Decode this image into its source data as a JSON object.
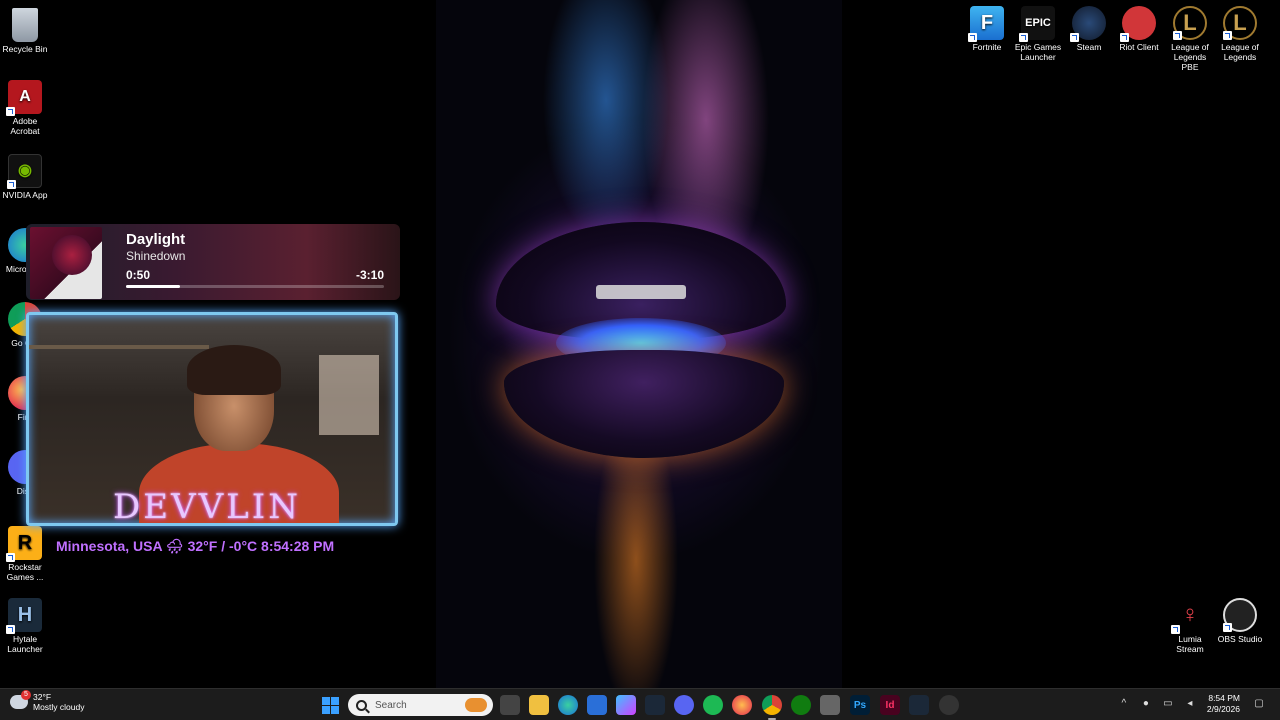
{
  "desktop_icons_left": [
    {
      "label": "Recycle Bin",
      "icon": "recycle-bin-icon"
    },
    {
      "label": "Adobe Acrobat",
      "icon": "adobe-acrobat-icon"
    },
    {
      "label": "NVIDIA App",
      "icon": "nvidia-icon"
    },
    {
      "label": "Micro Edg",
      "icon": "edge-icon"
    },
    {
      "label": "Go Chr",
      "icon": "chrome-icon"
    },
    {
      "label": "Fire",
      "icon": "firefox-icon"
    },
    {
      "label": "Disc",
      "icon": "discord-icon"
    },
    {
      "label": "Rockstar Games ...",
      "icon": "rockstar-icon"
    },
    {
      "label": "Hytale Launcher",
      "icon": "hytale-icon"
    }
  ],
  "desktop_icons_top_right": [
    {
      "label": "Fortnite",
      "icon": "fortnite-icon"
    },
    {
      "label": "Epic Games Launcher",
      "icon": "epic-games-icon",
      "glyph": "EPIC"
    },
    {
      "label": "Steam",
      "icon": "steam-icon"
    },
    {
      "label": "Riot Client",
      "icon": "riot-icon"
    },
    {
      "label": "League of Legends PBE",
      "icon": "league-pbe-icon"
    },
    {
      "label": "League of Legends",
      "icon": "league-icon"
    }
  ],
  "desktop_icons_bottom_right": [
    {
      "label": "Lumia Stream",
      "icon": "lumia-stream-icon"
    },
    {
      "label": "OBS Studio",
      "icon": "obs-icon"
    }
  ],
  "now_playing": {
    "title": "Daylight",
    "artist": "Shinedown",
    "elapsed": "0:50",
    "remaining": "-3:10",
    "progress_fraction": 0.21
  },
  "webcam": {
    "overlay_name": "DEVVLIN",
    "info_line": "Minnesota, USA 🌧 32°F / -0°C  8:54:28 PM"
  },
  "taskbar": {
    "weather_temp": "32°F",
    "weather_desc": "Mostly cloudy",
    "weather_badge": "5",
    "search_placeholder": "Search",
    "apps": [
      "task-view",
      "file-explorer",
      "edge",
      "store",
      "copilot",
      "steam",
      "discord",
      "spotify",
      "firefox",
      "chrome",
      "xbox",
      "capture",
      "photoshop",
      "indesign",
      "steam-2",
      "settings"
    ],
    "clock_time": "8:54 PM",
    "clock_date": "2/9/2026"
  },
  "colors": {
    "taskbar_bg": "#1c1c1c",
    "webcam_border": "#7ec8f0",
    "info_text": "#c070ff",
    "windows_blue": "#3aa0ff"
  }
}
